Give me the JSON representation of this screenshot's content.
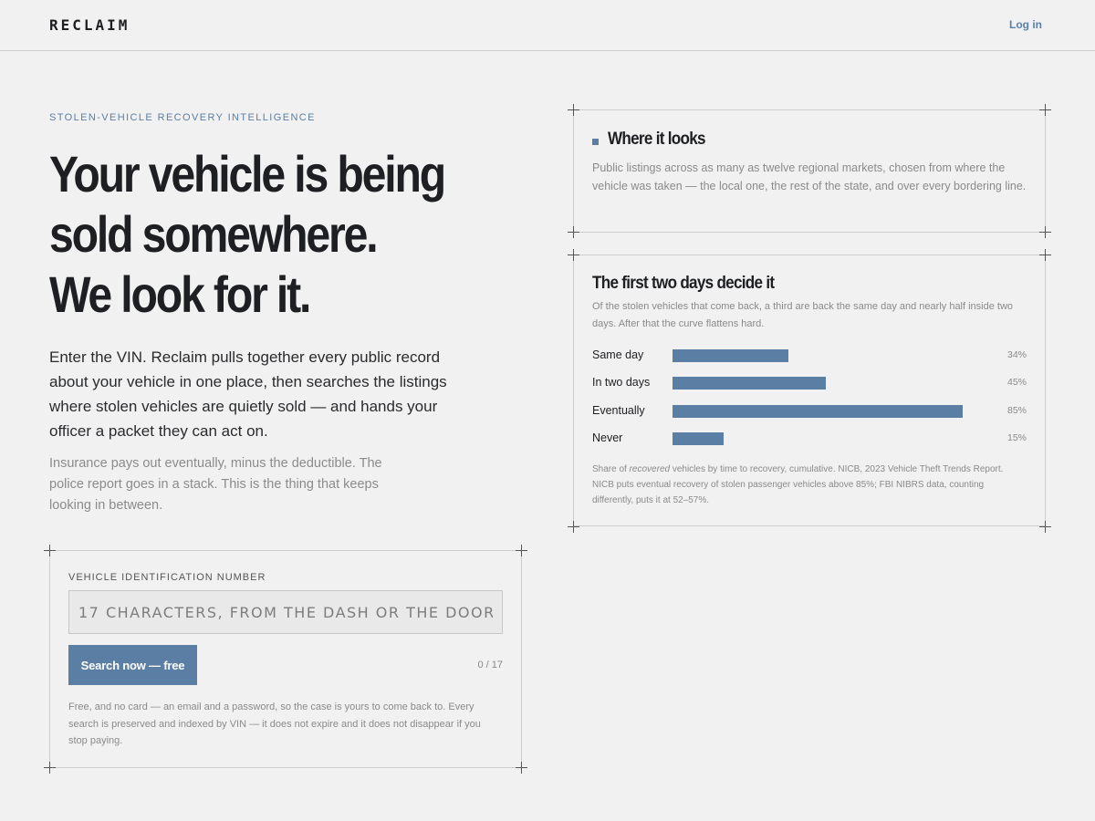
{
  "header": {
    "brand": "RECLAIM",
    "login_label": "Log in"
  },
  "hero": {
    "eyebrow": "STOLEN-VEHICLE RECOVERY INTELLIGENCE",
    "headline_lines": [
      "Your vehicle is being",
      "sold somewhere.",
      "We look for it."
    ],
    "lede": "Enter the VIN. Reclaim pulls together every public record about your vehicle in one place, then searches the listings where stolen vehicles are quietly sold — and hands your officer a packet they can act on.",
    "sub": "Insurance pays out eventually, minus the deductible. The police report goes in a stack. This is the thing that keeps looking in between."
  },
  "vin_form": {
    "label": "VEHICLE IDENTIFICATION NUMBER",
    "placeholder": "17 CHARACTERS, FROM THE DASH OR THE DOOR",
    "value": "",
    "button_label": "Search now — free",
    "counter": "0 / 17",
    "fineprint": "Free, and no card — an email and a password, so the case is yours to come back to. Every search is preserved and indexed by VIN — it does not expire and it does not disappear if you stop paying."
  },
  "where_panel": {
    "title": "Where it looks",
    "body": "Public listings across as many as twelve regional markets, chosen from where the vehicle was taken — the local one, the rest of the state, and over every bordering line."
  },
  "recovery_panel": {
    "title": "The first two days decide it",
    "subtitle": "Of the stolen vehicles that come back, a third are back the same day and nearly half inside two days. After that the curve flattens hard.",
    "source_prefix": "Share of ",
    "source_emphasis": "recovered",
    "source_suffix": " vehicles by time to recovery, cumulative. NICB, 2023 Vehicle Theft Trends Report. NICB puts eventual recovery of stolen passenger vehicles above 85%; FBI NIBRS data, counting differently, puts it at 52–57%."
  },
  "chart_data": {
    "type": "bar",
    "orientation": "horizontal",
    "title": "The first two days decide it",
    "categories": [
      "Same day",
      "In two days",
      "Eventually",
      "Never"
    ],
    "values": [
      34,
      45,
      85,
      15
    ],
    "value_labels": [
      "34%",
      "45%",
      "85%",
      "15%"
    ],
    "xlim": [
      0,
      100
    ],
    "grid": false,
    "color": "#5b7ea5"
  },
  "colors": {
    "accent": "#5b7ea5",
    "background": "#f1f1f1",
    "text": "#1e1f22",
    "muted": "#8a8a8a"
  }
}
